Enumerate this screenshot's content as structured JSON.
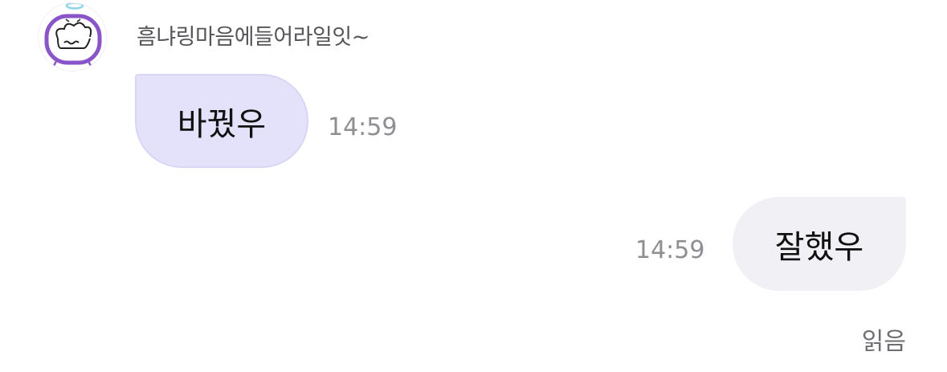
{
  "sender": {
    "name": "흠냐링마음에들어라일잇~",
    "avatar_icon": "cloud-character-with-halo-icon"
  },
  "messages": [
    {
      "direction": "incoming",
      "text": "바꿨우",
      "time": "14:59",
      "bubble_color": "#e4e2fb"
    },
    {
      "direction": "outgoing",
      "text": "잘했우",
      "time": "14:59",
      "bubble_color": "#f1f1f5"
    }
  ],
  "status": {
    "read_label": "읽음"
  },
  "colors": {
    "avatar_stroke": "#8a55c9",
    "halo": "#8fd3e8",
    "time_text": "#8e8e93"
  }
}
